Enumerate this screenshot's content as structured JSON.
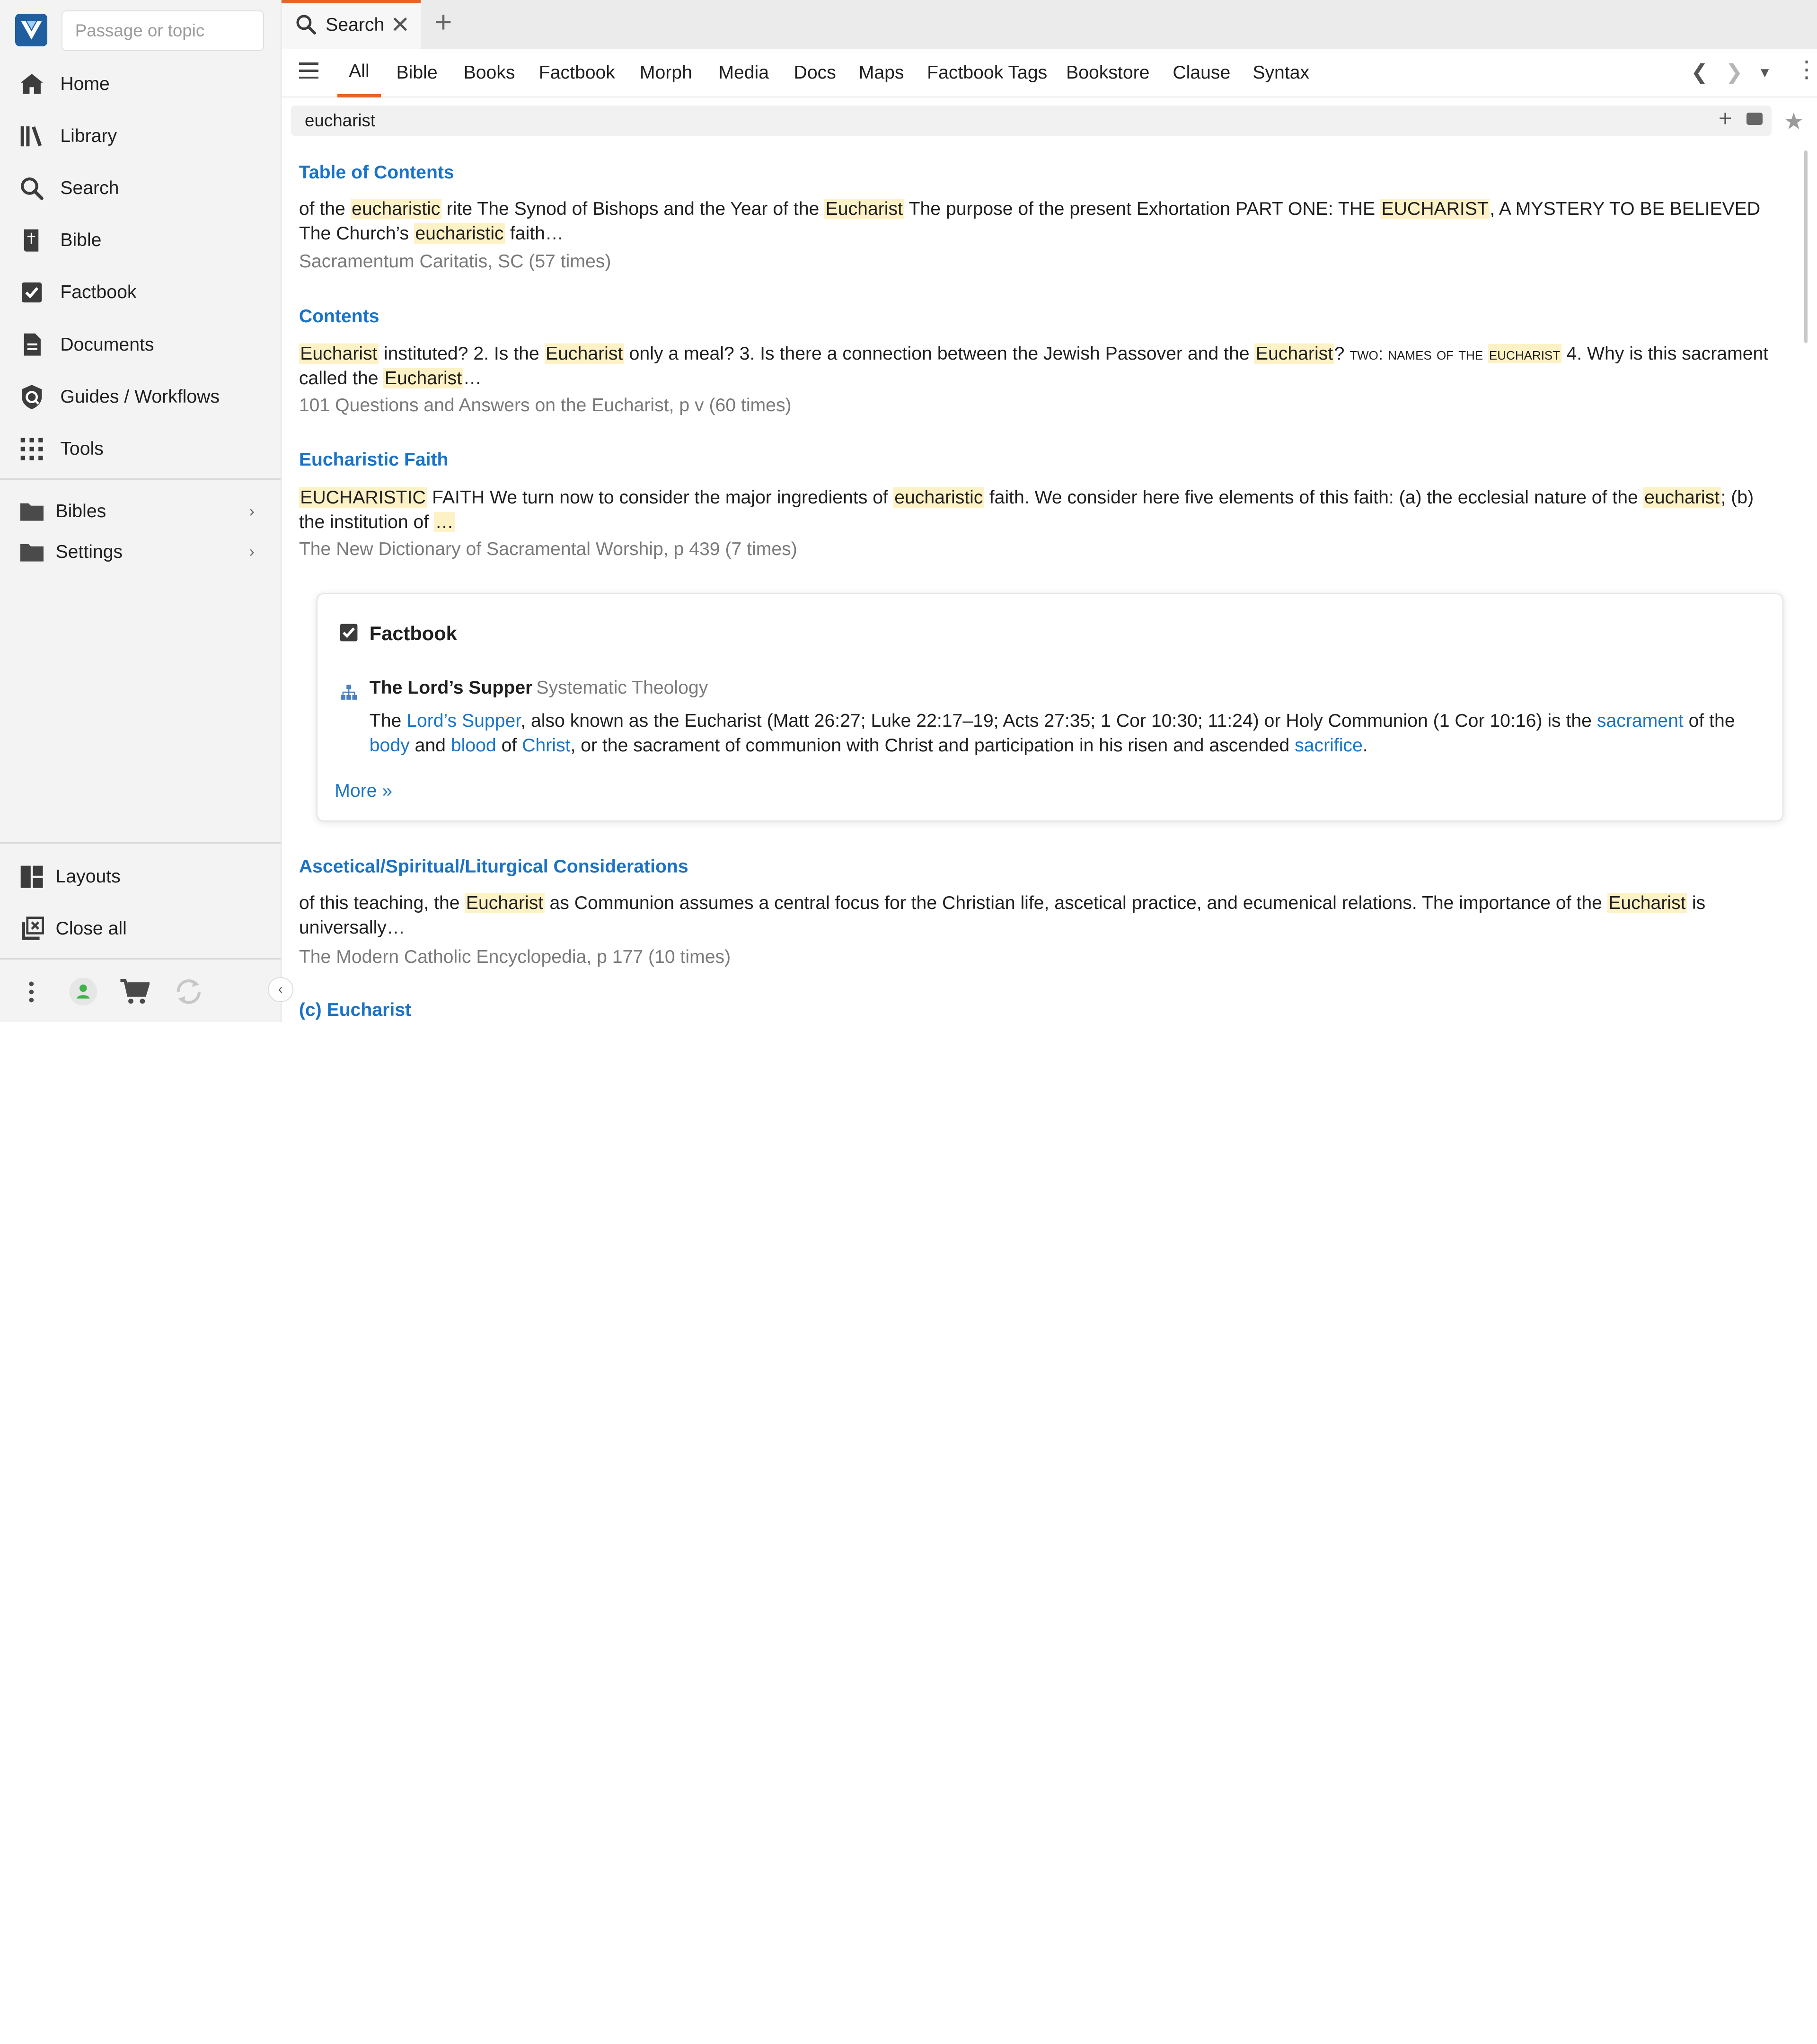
{
  "sidebar": {
    "passage_placeholder": "Passage or topic",
    "nav": [
      {
        "label": "Home",
        "icon": "home-icon"
      },
      {
        "label": "Library",
        "icon": "library-icon"
      },
      {
        "label": "Search",
        "icon": "search-icon"
      },
      {
        "label": "Bible",
        "icon": "bible-icon"
      },
      {
        "label": "Factbook",
        "icon": "factbook-icon"
      },
      {
        "label": "Documents",
        "icon": "documents-icon"
      },
      {
        "label": "Guides / Workflows",
        "icon": "guides-icon"
      },
      {
        "label": "Tools",
        "icon": "tools-icon"
      }
    ],
    "folders": [
      {
        "label": "Bibles",
        "icon": "folder-icon"
      },
      {
        "label": "Settings",
        "icon": "folder-icon"
      }
    ],
    "bottom": [
      {
        "label": "Layouts",
        "icon": "layouts-icon"
      },
      {
        "label": "Close all",
        "icon": "close-all-icon"
      }
    ]
  },
  "tab": {
    "label": "Search",
    "close": "✕",
    "add": "+"
  },
  "subnav": {
    "tabs": [
      "All",
      "Bible",
      "Books",
      "Factbook",
      "Morph",
      "Media",
      "Docs",
      "Maps",
      "Factbook Tags",
      "Bookstore",
      "Clause",
      "Syntax"
    ],
    "active": "All"
  },
  "search": {
    "query": "eucharist"
  },
  "results": [
    {
      "title": "Table of Contents",
      "source": "Sacramentum Caritatis, SC (57 times)"
    },
    {
      "title": "Contents",
      "source": "101 Questions and Answers on the Eucharist, p v (60 times)"
    },
    {
      "title": "Eucharistic Faith",
      "source": "The New Dictionary of Sacramental Worship, p 439 (7 times)"
    },
    {
      "title": "Ascetical/Spiritual/Liturgical Considerations",
      "source": "The Modern Catholic Encyclopedia, p 177 (10 times)"
    },
    {
      "title": "(c) Eucharist"
    }
  ],
  "snippets": {
    "r1": [
      "of the ",
      "eucharistic",
      " rite The Synod of Bishops and the Year of the ",
      "Eucharist",
      " The purpose of the present Exhortation PART ONE: THE ",
      "EUCHARIST",
      ", A MYSTERY TO BE BELIEVED The Church’s ",
      "eucharistic",
      " faith…"
    ],
    "r2": [
      "Eucharist",
      " instituted? 2. Is the ",
      "Eucharist",
      " only a meal? 3. Is there a connection between the Jewish Passover and the ",
      "Eucharist",
      "? ",
      "two: names of the ",
      "eucharist",
      " 4. Why is this sacrament called the ",
      "Eucharist",
      "…"
    ],
    "r3": [
      "EUCHARISTIC",
      " FAITH We turn now to consider the major ingredients of ",
      "eucharistic",
      " faith. We consider here five elements of this faith: (a) the ecclesial nature of the ",
      "eucharist",
      "; (b) the institution of ",
      "…"
    ],
    "r4": [
      "of this teaching, the ",
      "Eucharist",
      " as Communion assumes a central focus for the Christian life, ascetical practice, and ecumenical relations. The importance of the ",
      "Eucharist",
      " is universally…"
    ]
  },
  "factbook": {
    "header": "Factbook",
    "entry_title": "The Lord’s Supper",
    "entry_category": "Systematic Theology",
    "text": [
      "The ",
      "Lord’s Supper",
      ", also known as the Eucharist (Matt 26:27; Luke 22:17–19; Acts 27:35; 1 Cor 10:30; 11:24) or Holy Communion (1 Cor 10:16) is the ",
      "sacrament",
      " of the ",
      "body",
      " and ",
      "blood",
      " of ",
      "Christ",
      ", or the sacrament of communion with Christ and participation in his risen and ascended ",
      "sacrifice",
      "."
    ],
    "more": "More »"
  },
  "colors": {
    "accent": "#e8622c",
    "link": "#1a73c8",
    "highlight": "#fdf1c6",
    "logo": "#1f5f9f"
  }
}
